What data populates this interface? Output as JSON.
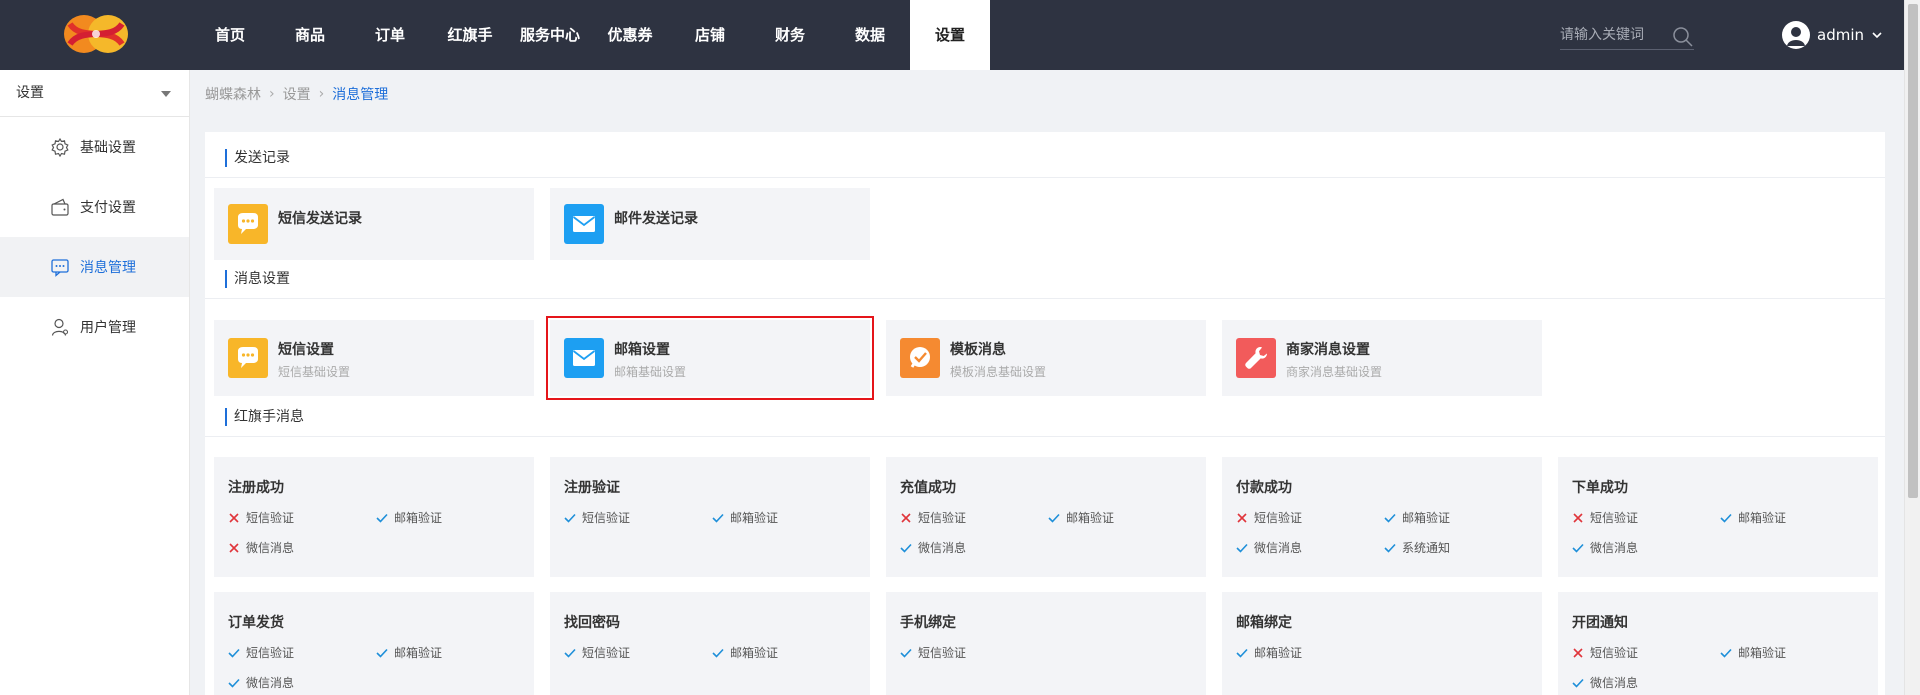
{
  "header": {
    "nav": [
      "首页",
      "商品",
      "订单",
      "红旗手",
      "服务中心",
      "优惠券",
      "店铺",
      "财务",
      "数据",
      "设置"
    ],
    "active_index": 9,
    "search_placeholder": "请输入关键词",
    "username": "admin"
  },
  "sidebar": {
    "select_label": "设置",
    "items": [
      {
        "label": "基础设置",
        "icon": "gear-icon"
      },
      {
        "label": "支付设置",
        "icon": "wallet-icon"
      },
      {
        "label": "消息管理",
        "icon": "chat-icon",
        "active": true
      },
      {
        "label": "用户管理",
        "icon": "user-icon"
      }
    ]
  },
  "breadcrumb": [
    "蝴蝶森林",
    "设置",
    "消息管理"
  ],
  "sections": {
    "send_records": "发送记录",
    "msg_settings": "消息设置",
    "hqs_msgs": "红旗手消息"
  },
  "records": [
    {
      "title": "短信发送记录",
      "icon": "sms-icon",
      "color": "#f8b629"
    },
    {
      "title": "邮件发送记录",
      "icon": "mail-icon",
      "color": "#1d9ff2"
    }
  ],
  "settings": [
    {
      "title": "短信设置",
      "sub": "短信基础设置",
      "icon": "sms-icon",
      "color": "#f8b629"
    },
    {
      "title": "邮箱设置",
      "sub": "邮箱基础设置",
      "icon": "mail-icon",
      "color": "#1d9ff2",
      "selected": true
    },
    {
      "title": "模板消息",
      "sub": "模板消息基础设置",
      "icon": "check-bubble-icon",
      "color": "#f58a31"
    },
    {
      "title": "商家消息设置",
      "sub": "商家消息基础设置",
      "icon": "wrench-icon",
      "color": "#f25b5b"
    }
  ],
  "messages": [
    {
      "title": "注册成功",
      "opts": [
        {
          "label": "短信验证",
          "on": false
        },
        {
          "label": "邮箱验证",
          "on": true
        },
        {
          "label": "微信消息",
          "on": false
        }
      ]
    },
    {
      "title": "注册验证",
      "opts": [
        {
          "label": "短信验证",
          "on": true
        },
        {
          "label": "邮箱验证",
          "on": true
        }
      ]
    },
    {
      "title": "充值成功",
      "opts": [
        {
          "label": "短信验证",
          "on": false
        },
        {
          "label": "邮箱验证",
          "on": true
        },
        {
          "label": "微信消息",
          "on": true
        }
      ]
    },
    {
      "title": "付款成功",
      "opts": [
        {
          "label": "短信验证",
          "on": false
        },
        {
          "label": "邮箱验证",
          "on": true
        },
        {
          "label": "微信消息",
          "on": true
        },
        {
          "label": "系统通知",
          "on": true
        }
      ]
    },
    {
      "title": "下单成功",
      "opts": [
        {
          "label": "短信验证",
          "on": false
        },
        {
          "label": "邮箱验证",
          "on": true
        },
        {
          "label": "微信消息",
          "on": true
        }
      ]
    },
    {
      "title": "订单发货",
      "opts": [
        {
          "label": "短信验证",
          "on": true
        },
        {
          "label": "邮箱验证",
          "on": true
        },
        {
          "label": "微信消息",
          "on": true
        }
      ]
    },
    {
      "title": "找回密码",
      "opts": [
        {
          "label": "短信验证",
          "on": true
        },
        {
          "label": "邮箱验证",
          "on": true
        }
      ]
    },
    {
      "title": "手机绑定",
      "opts": [
        {
          "label": "短信验证",
          "on": true
        }
      ]
    },
    {
      "title": "邮箱绑定",
      "opts": [
        {
          "label": "邮箱验证",
          "on": true
        }
      ]
    },
    {
      "title": "开团通知",
      "opts": [
        {
          "label": "短信验证",
          "on": false
        },
        {
          "label": "邮箱验证",
          "on": true
        },
        {
          "label": "微信消息",
          "on": true
        }
      ]
    }
  ],
  "colors": {
    "accent": "#1e6fd9",
    "check": "#1e8fd9",
    "cross": "#e0353b",
    "topbar": "#2e3341"
  }
}
